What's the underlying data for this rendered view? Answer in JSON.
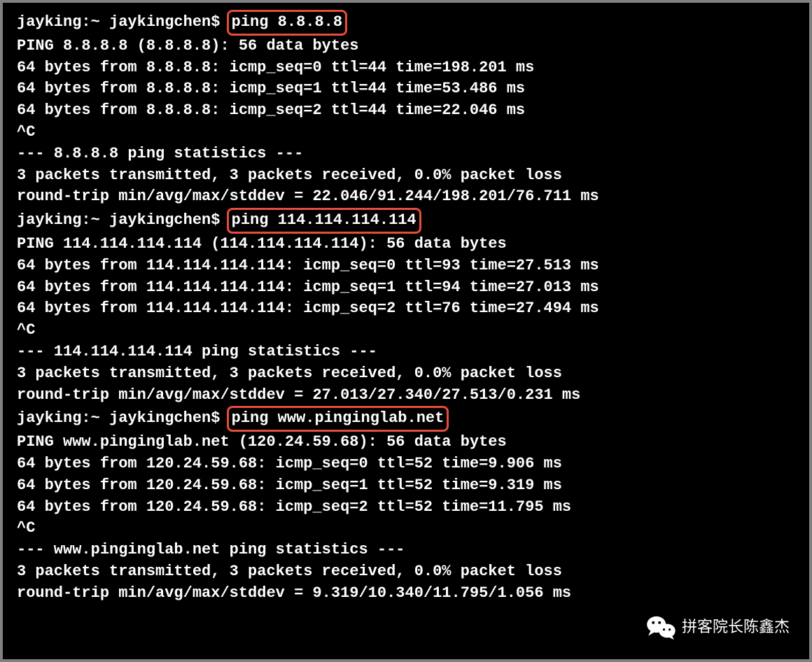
{
  "ping1": {
    "prompt": "jayking:~ jaykingchen$ ",
    "command": "ping 8.8.8.8",
    "header": "PING 8.8.8.8 (8.8.8.8): 56 data bytes",
    "replies": [
      "64 bytes from 8.8.8.8: icmp_seq=0 ttl=44 time=198.201 ms",
      "64 bytes from 8.8.8.8: icmp_seq=1 ttl=44 time=53.486 ms",
      "64 bytes from 8.8.8.8: icmp_seq=2 ttl=44 time=22.046 ms"
    ],
    "interrupt": "^C",
    "stats_header": "--- 8.8.8.8 ping statistics ---",
    "stats_line1": "3 packets transmitted, 3 packets received, 0.0% packet loss",
    "stats_line2": "round-trip min/avg/max/stddev = 22.046/91.244/198.201/76.711 ms"
  },
  "ping2": {
    "prompt": "jayking:~ jaykingchen$ ",
    "command": "ping 114.114.114.114",
    "header": "PING 114.114.114.114 (114.114.114.114): 56 data bytes",
    "replies": [
      "64 bytes from 114.114.114.114: icmp_seq=0 ttl=93 time=27.513 ms",
      "64 bytes from 114.114.114.114: icmp_seq=1 ttl=94 time=27.013 ms",
      "64 bytes from 114.114.114.114: icmp_seq=2 ttl=76 time=27.494 ms"
    ],
    "interrupt": "^C",
    "stats_header": "--- 114.114.114.114 ping statistics ---",
    "stats_line1": "3 packets transmitted, 3 packets received, 0.0% packet loss",
    "stats_line2": "round-trip min/avg/max/stddev = 27.013/27.340/27.513/0.231 ms"
  },
  "ping3": {
    "prompt": "jayking:~ jaykingchen$ ",
    "command": "ping www.pinginglab.net",
    "header": "PING www.pinginglab.net (120.24.59.68): 56 data bytes",
    "replies": [
      "64 bytes from 120.24.59.68: icmp_seq=0 ttl=52 time=9.906 ms",
      "64 bytes from 120.24.59.68: icmp_seq=1 ttl=52 time=9.319 ms",
      "64 bytes from 120.24.59.68: icmp_seq=2 ttl=52 time=11.795 ms"
    ],
    "interrupt": "^C",
    "stats_header": "--- www.pinginglab.net ping statistics ---",
    "stats_line1": "3 packets transmitted, 3 packets received, 0.0% packet loss",
    "stats_line2": "round-trip min/avg/max/stddev = 9.319/10.340/11.795/1.056 ms"
  },
  "watermark": "拼客院长陈鑫杰"
}
